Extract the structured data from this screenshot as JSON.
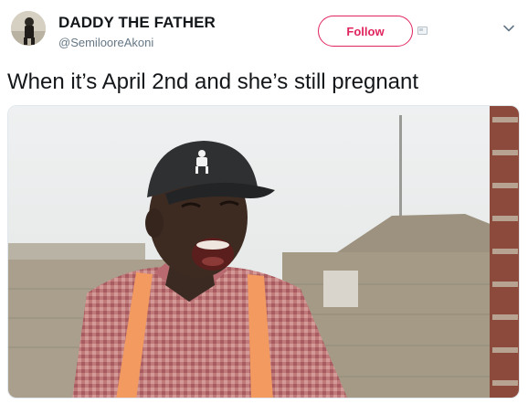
{
  "tweet": {
    "display_name": "DADDY THE FATHER",
    "handle": "@SemiloorеAkoni",
    "follow_label": "Follow",
    "text": "When it’s April 2nd and she’s still pregnant"
  },
  "icons": {
    "more": "chevron-down-icon",
    "card": "card-icon"
  },
  "colors": {
    "follow_accent": "#e0245e",
    "handle_gray": "#657786"
  }
}
